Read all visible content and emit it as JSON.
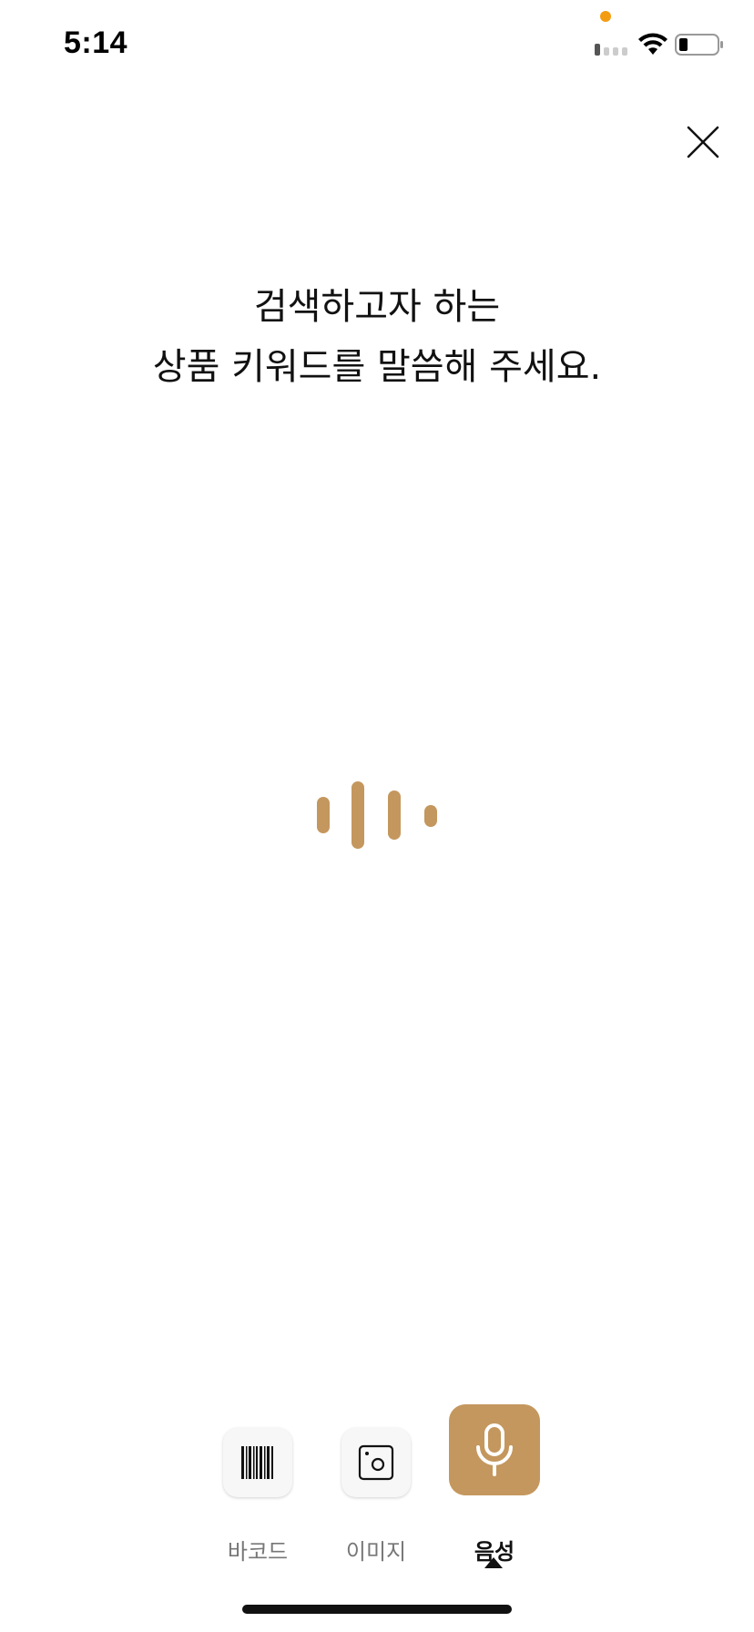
{
  "status_bar": {
    "time": "5:14"
  },
  "colors": {
    "accent": "#c4975e",
    "privacy_dot": "#f39c12",
    "text": "#111111",
    "muted": "#777777"
  },
  "prompt": {
    "line1": "검색하고자 하는",
    "line2": "상품 키워드를 말씀해 주세요."
  },
  "modes": {
    "items": [
      {
        "id": "barcode",
        "label": "바코드",
        "icon": "barcode-icon",
        "active": false
      },
      {
        "id": "image",
        "label": "이미지",
        "icon": "image-icon",
        "active": false
      },
      {
        "id": "voice",
        "label": "음성",
        "icon": "microphone-icon",
        "active": true
      }
    ]
  }
}
